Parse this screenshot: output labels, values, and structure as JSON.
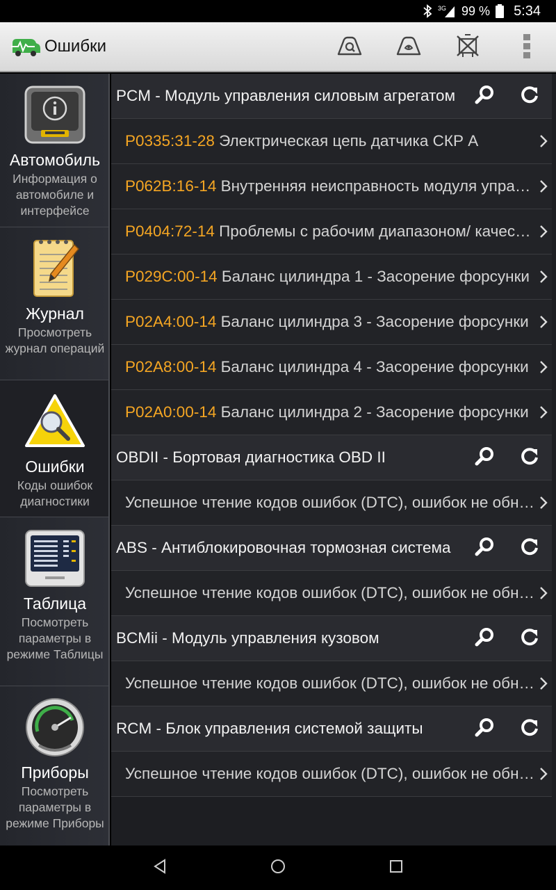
{
  "status_bar": {
    "battery": "99 %",
    "time": "5:34",
    "network": "3G",
    "icons": [
      "bluetooth-icon",
      "signal-icon",
      "battery-icon"
    ]
  },
  "action_bar": {
    "title": "Ошибки",
    "actions": [
      "read-codes-icon",
      "clear-codes-icon",
      "clear-all-icon",
      "overflow-menu-icon"
    ]
  },
  "sidebar": {
    "items": [
      {
        "label": "Автомобиль",
        "desc": "Информация о автомобиле и интерфейсе",
        "icon": "car-info-icon"
      },
      {
        "label": "Журнал",
        "desc": "Просмотреть журнал операций",
        "icon": "notepad-icon"
      },
      {
        "label": "Ошибки",
        "desc": "Коды ошибок диагностики",
        "icon": "warning-magnifier-icon"
      },
      {
        "label": "Таблица",
        "desc": "Посмотреть параметры в режиме Таблицы",
        "icon": "table-monitor-icon"
      },
      {
        "label": "Приборы",
        "desc": "Посмотреть параметры в режиме Приборы",
        "icon": "gauge-icon"
      }
    ]
  },
  "rows": [
    {
      "type": "header",
      "text": "PCM - Модуль управления силовым агрегатом"
    },
    {
      "type": "item",
      "code": "P0335:31-28",
      "text": "Электрическая цепь датчика СКР А"
    },
    {
      "type": "item",
      "code": "P062B:16-14",
      "text": "Внутренняя неисправность модуля управления"
    },
    {
      "type": "item",
      "code": "P0404:72-14",
      "text": "Проблемы с рабочим диапазоном/ качеством"
    },
    {
      "type": "item",
      "code": "P029C:00-14",
      "text": "Баланс цилиндра 1 - Засорение форсунки"
    },
    {
      "type": "item",
      "code": "P02A4:00-14",
      "text": "Баланс цилиндра 3 - Засорение форсунки"
    },
    {
      "type": "item",
      "code": "P02A8:00-14",
      "text": "Баланс цилиндра 4 - Засорение форсунки"
    },
    {
      "type": "item",
      "code": "P02A0:00-14",
      "text": "Баланс цилиндра 2 - Засорение форсунки"
    },
    {
      "type": "header",
      "text": "OBDII - Бортовая диагностика OBD II"
    },
    {
      "type": "item",
      "code": "",
      "text": "Успешное чтение кодов ошибок (DTC), ошибок не обнаружено"
    },
    {
      "type": "header",
      "text": "ABS - Антиблокировочная тормозная система"
    },
    {
      "type": "item",
      "code": "",
      "text": "Успешное чтение кодов ошибок (DTC), ошибок не обнаружено"
    },
    {
      "type": "header",
      "text": "BCMii - Модуль управления кузовом"
    },
    {
      "type": "item",
      "code": "",
      "text": "Успешное чтение кодов ошибок (DTC), ошибок не обнаружено"
    },
    {
      "type": "header",
      "text": "RCM - Блок управления системой защиты"
    },
    {
      "type": "item",
      "code": "",
      "text": "Успешное чтение кодов ошибок (DTC), ошибок не обнаружено"
    }
  ],
  "nav_bar": [
    "back-icon",
    "home-icon",
    "recents-icon"
  ],
  "colors": {
    "dtc_code": "#f5a623",
    "accent": "#4caf50"
  }
}
